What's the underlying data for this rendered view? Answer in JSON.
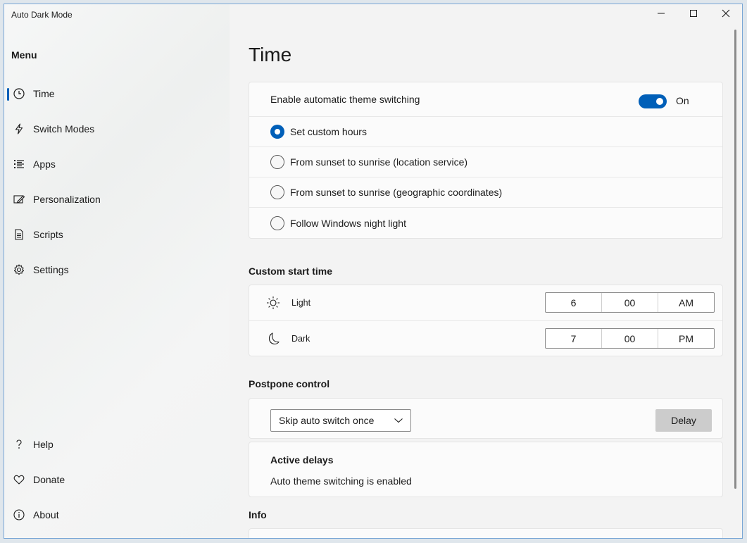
{
  "window": {
    "title": "Auto Dark Mode"
  },
  "sidebar": {
    "header": "Menu",
    "items": [
      {
        "label": "Time",
        "icon": "clock-icon",
        "selected": true
      },
      {
        "label": "Switch Modes",
        "icon": "lightning-icon"
      },
      {
        "label": "Apps",
        "icon": "list-icon"
      },
      {
        "label": "Personalization",
        "icon": "personalization-icon"
      },
      {
        "label": "Scripts",
        "icon": "document-icon"
      },
      {
        "label": "Settings",
        "icon": "gear-icon"
      }
    ],
    "footer_items": [
      {
        "label": "Help",
        "icon": "help-icon"
      },
      {
        "label": "Donate",
        "icon": "heart-icon"
      },
      {
        "label": "About",
        "icon": "info-icon"
      }
    ]
  },
  "main": {
    "title": "Time",
    "auto_switch": {
      "label": "Enable automatic theme switching",
      "toggle_state": "On",
      "options": [
        {
          "label": "Set custom hours",
          "checked": true
        },
        {
          "label": "From sunset to sunrise (location service)",
          "checked": false
        },
        {
          "label": "From sunset to sunrise (geographic coordinates)",
          "checked": false
        },
        {
          "label": "Follow Windows night light",
          "checked": false
        }
      ]
    },
    "custom_start": {
      "heading": "Custom start time",
      "light": {
        "label": "Light",
        "hour": "6",
        "minute": "00",
        "period": "AM"
      },
      "dark": {
        "label": "Dark",
        "hour": "7",
        "minute": "00",
        "period": "PM"
      }
    },
    "postpone": {
      "heading": "Postpone control",
      "dropdown_value": "Skip auto switch once",
      "delay_button": "Delay",
      "active_delays_title": "Active delays",
      "active_delays_status": "Auto theme switching is enabled"
    },
    "info": {
      "heading": "Info"
    }
  },
  "colors": {
    "accent": "#005fb8",
    "window_border": "#7aa7d6"
  }
}
